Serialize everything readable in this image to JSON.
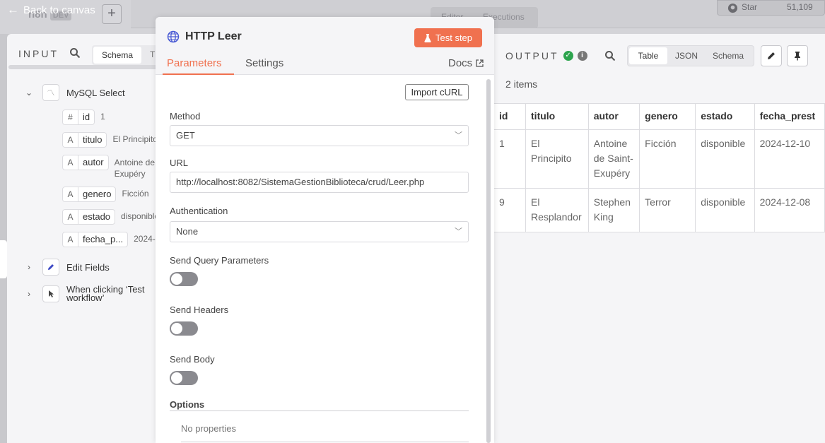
{
  "background": {
    "back_label": "Back to canvas",
    "faded_title": "n8n",
    "faded_tag": "DEV",
    "tab_editor": "Editor",
    "tab_executions": "Executions",
    "star_label": "Star",
    "star_count": "51,109"
  },
  "input": {
    "heading": "INPUT",
    "toggle_schema": "Schema",
    "toggle_other": "T",
    "nodes": [
      {
        "label": "MySQL Select"
      },
      {
        "label": "Edit Fields"
      },
      {
        "label": "When clicking ‘Test workflow’"
      }
    ],
    "fields": [
      {
        "type": "#",
        "name": "id",
        "value": "1"
      },
      {
        "type": "A",
        "name": "titulo",
        "value": "El Principito"
      },
      {
        "type": "A",
        "name": "autor",
        "value": "Antoine de",
        "value2": "Exupéry"
      },
      {
        "type": "A",
        "name": "genero",
        "value": "Ficción"
      },
      {
        "type": "A",
        "name": "estado",
        "value": "disponible"
      },
      {
        "type": "A",
        "name": "fecha_p...",
        "value": "2024-"
      }
    ]
  },
  "dialog": {
    "title": "HTTP Leer",
    "test_button": "Test step",
    "tab_parameters": "Parameters",
    "tab_settings": "Settings",
    "docs": "Docs",
    "import_button": "Import cURL",
    "method_label": "Method",
    "method_value": "GET",
    "url_label": "URL",
    "url_value": "http://localhost:8082/SistemaGestionBiblioteca/crud/Leer.php",
    "auth_label": "Authentication",
    "auth_value": "None",
    "send_query_label": "Send Query Parameters",
    "send_headers_label": "Send Headers",
    "send_body_label": "Send Body",
    "options_label": "Options",
    "no_properties": "No properties"
  },
  "output": {
    "heading": "OUTPUT",
    "toggle_table": "Table",
    "toggle_json": "JSON",
    "toggle_schema": "Schema",
    "items_count": "2 items",
    "columns": [
      "id",
      "titulo",
      "autor",
      "genero",
      "estado",
      "fecha_prest"
    ],
    "rows": [
      [
        "1",
        "El Principito",
        "Antoine de Saint-Exupéry",
        "Ficción",
        "disponible",
        "2024-12-10"
      ],
      [
        "9",
        "El Resplandor",
        "Stephen King",
        "Terror",
        "disponible",
        "2024-12-08"
      ]
    ]
  },
  "colors": {
    "accent": "#f0714f",
    "success": "#2da44e",
    "globe": "#4a5bd4",
    "edit_fields_icon": "#3b47c4"
  }
}
